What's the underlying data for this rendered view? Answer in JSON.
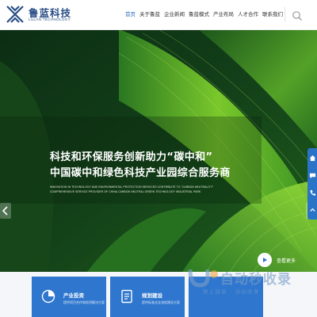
{
  "logo": {
    "name": "鲁蓝科技",
    "english": "LULAN TECHNOLOGY"
  },
  "nav": {
    "items": [
      {
        "label": "首页"
      },
      {
        "label": "关于鲁蓝"
      },
      {
        "label": "企业新闻"
      },
      {
        "label": "鲁蓝模式"
      },
      {
        "label": "产业布局"
      },
      {
        "label": "人才合作"
      },
      {
        "label": "联系我们"
      }
    ],
    "active_index": 0,
    "search_icon": "search-icon"
  },
  "hero": {
    "title_line1": "科技和环保服务创新助力“碳中和”",
    "title_line2": "中国碳中和绿色科技产业园综合服务商",
    "subtitle_line1": "INNOVATION IN TECHNOLOGY AND ENVIRONMENTAL PROTECTION SERVICES CONTRIBUTE TO \"CARBON NEUTRALITY\"",
    "subtitle_line2": "COMPREHENSIVE SERVICE PROVIDER OF CHINA CARBON NEUTRAL GREEN TECHNOLOGY INDUSTRIAL PARK",
    "more_label": "查看更多"
  },
  "cards": [
    {
      "title": "产业投资",
      "desc": "提供项目合作和投资解决方案",
      "icon": "pie-chart-icon"
    },
    {
      "title": "规划建设",
      "desc": "提供标准化全流程建设方案",
      "icon": "document-icon"
    }
  ],
  "watermark": {
    "text": "自动秒收录",
    "sub": "放上链接 · 自动收录"
  },
  "colors": {
    "brand_blue": "#2a4f86",
    "accent_blue": "#2e76ce",
    "nav_active": "#2b6fc4",
    "leaf_dark": "#0c2e14",
    "leaf_bright": "#7fcf2c"
  }
}
